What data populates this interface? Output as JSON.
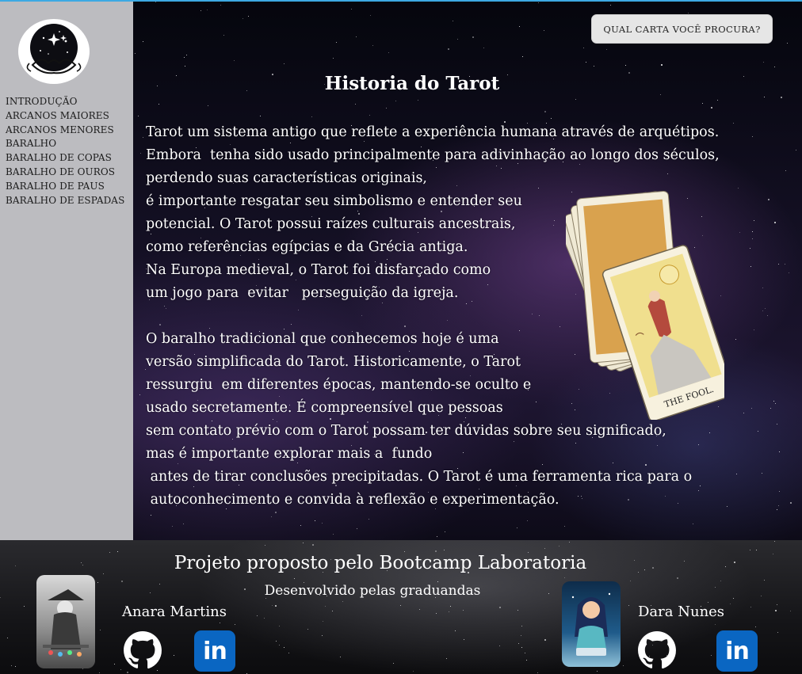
{
  "sidebar": {
    "logo_icon": "tarot-hands-stars-logo-icon",
    "items": [
      {
        "label": "INTRODUÇÃO"
      },
      {
        "label": "ARCANOS MAIORES"
      },
      {
        "label": "ARCANOS MENORES"
      },
      {
        "label": "BARALHO"
      },
      {
        "label": "BARALHO DE COPAS"
      },
      {
        "label": "BARALHO DE OUROS"
      },
      {
        "label": "BARALHO DE PAUS"
      },
      {
        "label": "BARALHO DE ESPADAS"
      }
    ]
  },
  "header": {
    "search_button_label": "QUAL CARTA VOCÊ PROCURA?"
  },
  "main": {
    "title": "Historia do Tarot",
    "paragraph1_lines": [
      "Tarot um sistema antigo que reflete a experiência humana através de arquétipos.",
      "Embora  tenha sido usado principalmente para adivinhação ao longo dos séculos,",
      "perdendo suas características originais,",
      "é importante resgatar seu simbolismo e entender seu",
      "potencial. O Tarot possui raízes culturais ancestrais,",
      "como referências egípcias e da Grécia antiga.",
      "Na Europa medieval, o Tarot foi disfarçado como",
      "um jogo para  evitar   perseguição da igreja."
    ],
    "paragraph2_lines": [
      "O baralho tradicional que conhecemos hoje é uma",
      "versão simplificada do Tarot. Historicamente, o Tarot",
      "ressurgiu  em diferentes épocas, mantendo-se oculto e",
      "usado secretamente. É compreensível que pessoas",
      "sem contato prévio com o Tarot possam ter dúvidas sobre seu significado,",
      "mas é importante explorar mais a  fundo",
      " antes de tirar conclusões precipitadas. O Tarot é uma ferramenta rica para o",
      " autoconhecimento e convida à reflexão e experimentação."
    ],
    "card_image_caption": "THE FOOL."
  },
  "footer": {
    "title": "Projeto proposto pelo Bootcamp Laboratoria",
    "subtitle": "Desenvolvido pelas graduandas",
    "developers": [
      {
        "name": "Anara Martins",
        "github_icon": "github-icon",
        "linkedin_icon": "linkedin-icon",
        "linkedin_label": "in"
      },
      {
        "name": "Dara Nunes",
        "github_icon": "github-icon",
        "linkedin_icon": "linkedin-icon",
        "linkedin_label": "in"
      }
    ]
  },
  "colors": {
    "sidebar_bg": "#bcbcc0",
    "search_button_bg": "#e6e6e6",
    "linkedin_blue": "#0a66c2",
    "top_border": "#3da9e3"
  }
}
